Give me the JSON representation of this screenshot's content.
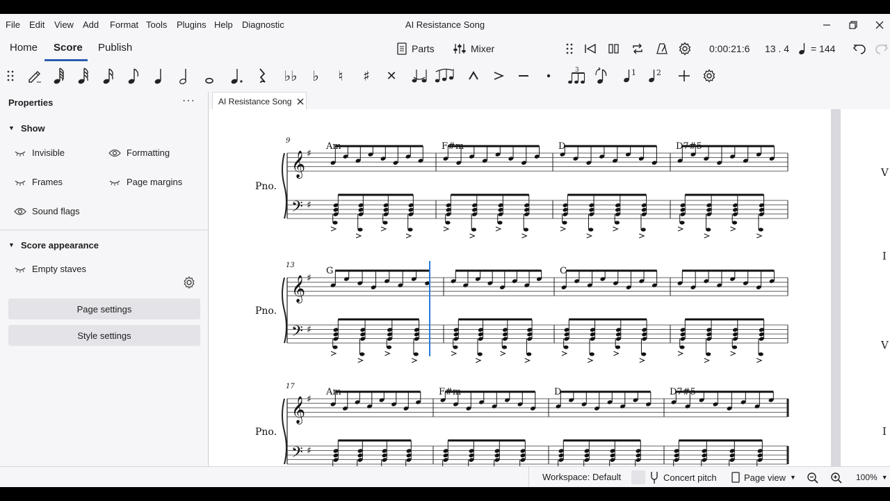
{
  "menubar": {
    "items": [
      "File",
      "Edit",
      "View",
      "Add",
      "Format",
      "Tools",
      "Plugins",
      "Help",
      "Diagnostic"
    ],
    "window_title": "AI Resistance Song"
  },
  "nav": {
    "tabs": [
      "Home",
      "Score",
      "Publish"
    ],
    "active_tab": "Score",
    "parts_label": "Parts",
    "mixer_label": "Mixer",
    "time": "0:00:21:6",
    "position": "13 . 4",
    "tempo": "= 144"
  },
  "toolbar": {
    "icons": [
      "toolbar-handle-icon",
      "note-input-icon",
      "64th-note-icon",
      "32nd-note-icon",
      "16th-note-icon",
      "eighth-note-icon",
      "quarter-note-icon",
      "half-note-icon",
      "whole-note-icon",
      "augmentation-dot-icon",
      "rest-icon",
      "double-flat-icon",
      "flat-icon",
      "natural-icon",
      "sharp-icon",
      "double-sharp-icon",
      "tie-icon",
      "slur-icon",
      "marcato-icon",
      "accent-icon",
      "tenuto-icon",
      "staccato-icon",
      "tuplet-icon",
      "flip-direction-icon",
      "voice-1-icon",
      "voice-2-icon",
      "add-icon",
      "customize-toolbar-icon"
    ]
  },
  "properties": {
    "title": "Properties",
    "show_section": "Show",
    "show_items": [
      "Invisible",
      "Formatting",
      "Frames",
      "Page margins",
      "Sound flags"
    ],
    "appearance_section": "Score appearance",
    "empty_staves": "Empty staves",
    "page_settings": "Page settings",
    "style_settings": "Style settings"
  },
  "doc_tab": {
    "label": "AI Resistance Song"
  },
  "score": {
    "instrument_label": "Pno.",
    "systems": [
      {
        "measure_number": "9",
        "chords": [
          "Am",
          "F#m",
          "D",
          "D7#5"
        ]
      },
      {
        "measure_number": "13",
        "chords": [
          "G",
          "",
          "C",
          ""
        ]
      },
      {
        "measure_number": "17",
        "chords": [
          "Am",
          "F#m",
          "D",
          "D7#5"
        ]
      }
    ],
    "next_page_letters": [
      "V",
      "I",
      "V",
      "I"
    ]
  },
  "statusbar": {
    "workspace": "Workspace: Default",
    "concert_pitch": "Concert pitch",
    "page_view": "Page view",
    "zoom": "100%"
  },
  "colors": {
    "accent": "#2a5db0",
    "background": "#f6f6f8",
    "page": "#ffffff"
  }
}
